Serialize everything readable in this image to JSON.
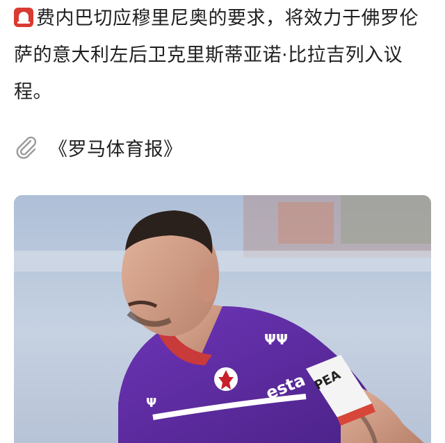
{
  "post": {
    "headline_text": "费内巴切应穆里尼奥的要求，将效力于佛罗伦萨的意大利左后卫克里斯蒂亚诺·比拉吉列入议程。",
    "headline_icon": "alarm-siren-icon",
    "source_icon": "paperclip-icon",
    "source_text": "《罗马体育报》",
    "photo": {
      "description_icon": "football-player-photo",
      "jersey_sponsor": "esta",
      "captain_band_text": "PEACE",
      "colors": {
        "jersey": "#5c2c9e",
        "background": "#bccbe0"
      }
    }
  }
}
